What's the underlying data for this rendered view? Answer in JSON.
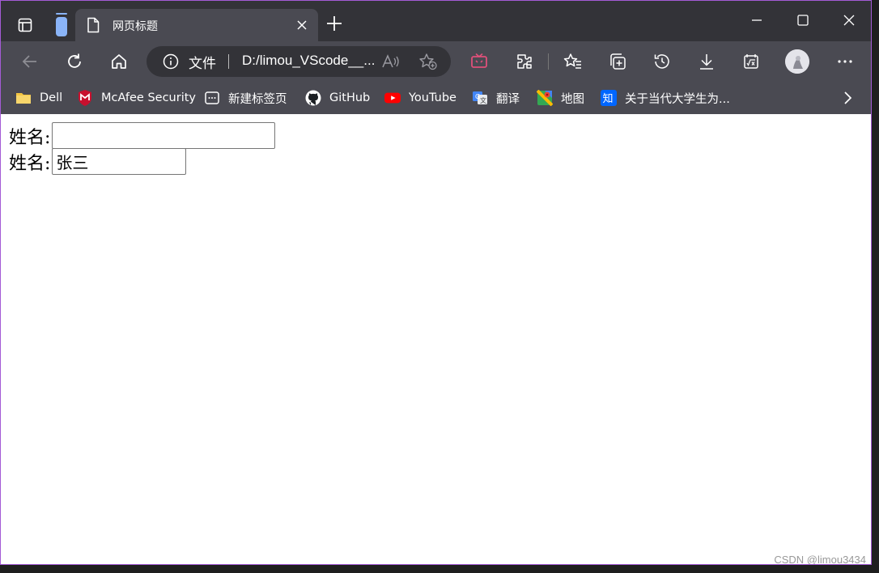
{
  "tab": {
    "title": "网页标题"
  },
  "address": {
    "scheme_label": "文件",
    "url": "D:/limou_VScode__..."
  },
  "bookmarks": [
    {
      "label": "Dell",
      "icon": "folder-icon"
    },
    {
      "label": "McAfee Security",
      "icon": "mcafee-icon"
    },
    {
      "label": "新建标签页",
      "icon": "new-tab-page-icon"
    },
    {
      "label": "GitHub",
      "icon": "github-icon"
    },
    {
      "label": "YouTube",
      "icon": "youtube-icon"
    },
    {
      "label": "翻译",
      "icon": "translate-icon"
    },
    {
      "label": "地图",
      "icon": "maps-icon"
    },
    {
      "label": "关于当代大学生为...",
      "icon": "zhihu-icon"
    }
  ],
  "form": {
    "rows": [
      {
        "label": "姓名:",
        "value": ""
      },
      {
        "label": "姓名:",
        "value": "张三"
      }
    ]
  },
  "watermark": "CSDN @limou3434",
  "colors": {
    "titlebar": "#333338",
    "toolbar": "#4a4a52",
    "window_border": "#a45bd6"
  }
}
